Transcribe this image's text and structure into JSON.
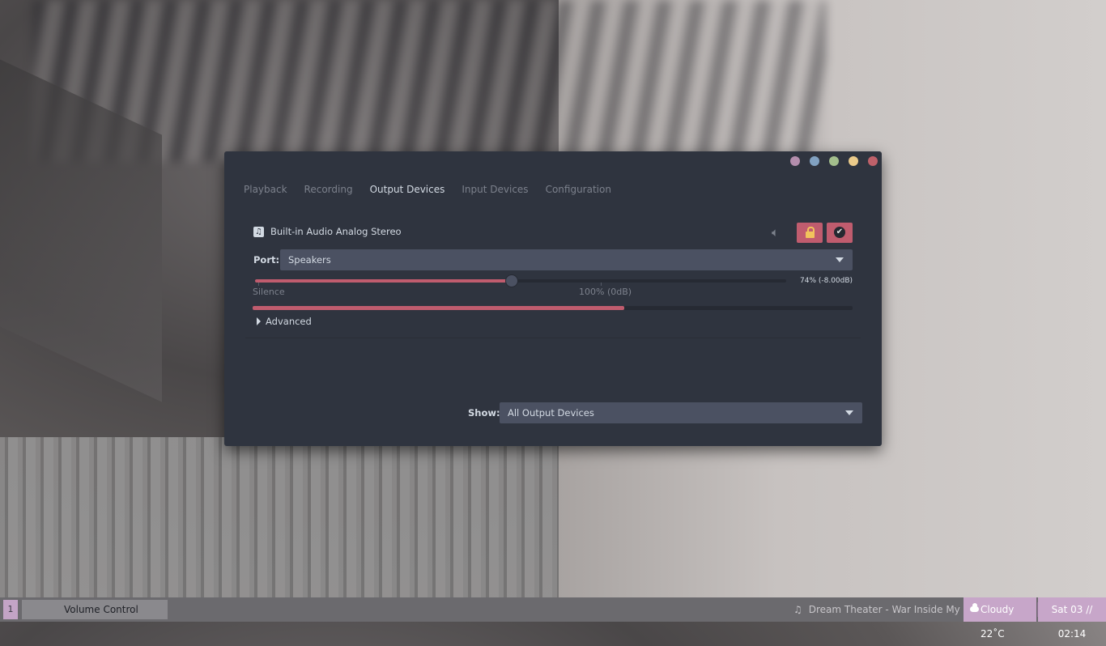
{
  "window": {
    "title_buttons": [
      {
        "name": "pin",
        "color": "#b48ead"
      },
      {
        "name": "sticky",
        "color": "#81a1c1"
      },
      {
        "name": "minimize",
        "color": "#a3be8c"
      },
      {
        "name": "maximize",
        "color": "#ebcb8b"
      },
      {
        "name": "close",
        "color": "#bf616a"
      }
    ],
    "tabs": [
      "Playback",
      "Recording",
      "Output Devices",
      "Input Devices",
      "Configuration"
    ],
    "active_tab": "Output Devices"
  },
  "device": {
    "icon": "music-note-icon",
    "name": "Built-in Audio Analog Stereo",
    "port_label": "Port:",
    "port_value": "Speakers",
    "volume_fraction": 0.74,
    "volume_text": "74% (-8.00dB)",
    "silence_label": "Silence",
    "hundred_label": "100% (0dB)",
    "peak_fraction": 0.62,
    "advanced_label": "Advanced",
    "accent_color": "#c05c6e"
  },
  "footer": {
    "show_label": "Show:",
    "show_value": "All Output Devices"
  },
  "taskbar": {
    "workspace": "1",
    "task": "Volume Control",
    "music_icon": "♫",
    "now_playing": "Dream Theater - War Inside My Head",
    "weather": "Cloudy 22˚C",
    "clock": "Sat 03 // 02:14"
  }
}
